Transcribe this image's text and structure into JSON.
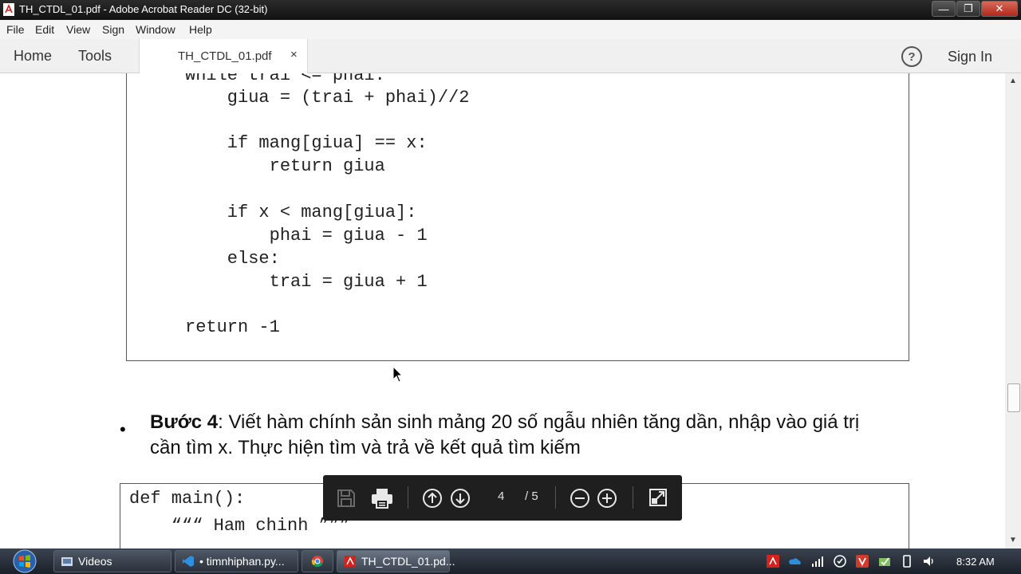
{
  "window": {
    "title": "TH_CTDL_01.pdf - Adobe Acrobat Reader DC (32-bit)",
    "controls": [
      "minimize",
      "maximize",
      "close"
    ]
  },
  "menu": [
    "File",
    "Edit",
    "View",
    "Sign",
    "Window",
    "Help"
  ],
  "tabs": {
    "home": "Home",
    "tools": "Tools",
    "document": "TH_CTDL_01.pdf",
    "close_glyph": "×",
    "help_glyph": "?",
    "sign_in": "Sign In"
  },
  "document": {
    "code_block_1": [
      "while trai <= phai:",
      "    giua = (trai + phai)//2",
      "",
      "    if mang[giua] == x:",
      "        return giua",
      "",
      "    if x < mang[giua]:",
      "        phai = giua - 1",
      "    else:",
      "        trai = giua + 1",
      "",
      "return -1"
    ],
    "step": {
      "bullet": "•",
      "label": "Bước 4",
      "line1": ": Viết hàm chính sản sinh mảng 20 số ngẫu nhiên tăng dần, nhập vào giá trị",
      "line2": "cần tìm x. Thực hiện tìm và trả về kết quả tìm kiếm"
    },
    "code_block_2": [
      "def main():",
      "    “““ Ham chinh ”””"
    ]
  },
  "floating_toolbar": {
    "current_page": "4",
    "total_pages": "/ 5",
    "icons": [
      "save-icon",
      "print-icon",
      "page-up-icon",
      "page-down-icon",
      "zoom-out-icon",
      "zoom-in-icon",
      "fit-page-icon"
    ]
  },
  "taskbar": {
    "items": [
      "Videos",
      "• timnhiphan.py...",
      "",
      "TH_CTDL_01.pd..."
    ],
    "clock": "8:32 AM"
  },
  "colors": {
    "titlebar": "#1a1a1a",
    "acrobat_red": "#d4221c",
    "taskbar": "#2a313b"
  }
}
